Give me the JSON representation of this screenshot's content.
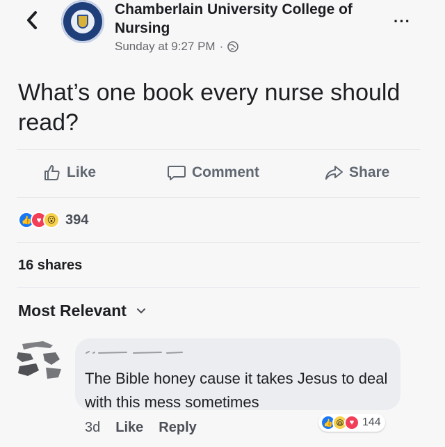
{
  "header": {
    "page_name": "Chamberlain University College of Nursing",
    "timestamp": "Sunday at 9:27 PM",
    "separator": "·",
    "privacy_icon": "globe-icon",
    "more_label": "···"
  },
  "post": {
    "text": "What’s one book every nurse should read?"
  },
  "actions": {
    "like": "Like",
    "comment": "Comment",
    "share": "Share"
  },
  "reactions": {
    "icons": [
      "like-reaction-icon",
      "love-reaction-icon",
      "wow-reaction-icon"
    ],
    "count": "394"
  },
  "shares": "16 shares",
  "sort": {
    "label": "Most Relevant"
  },
  "comment": {
    "text": "The Bible honey cause it takes Jesus to deal with this mess sometimes",
    "age": "3d",
    "like": "Like",
    "reply": "Reply",
    "reaction_icons": [
      "like-reaction-icon",
      "haha-reaction-icon",
      "love-reaction-icon"
    ],
    "reaction_count": "144"
  },
  "colors": {
    "like_blue": "#1877f2",
    "love_red": "#f33e58",
    "wow_yellow": "#f7d04c"
  }
}
